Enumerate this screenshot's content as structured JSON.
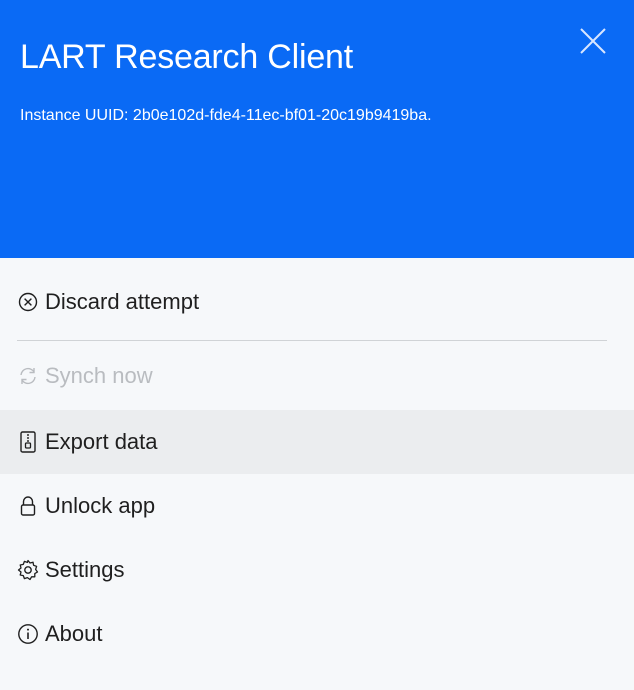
{
  "header": {
    "title": "LART Research Client",
    "uuid_text": "Instance UUID: 2b0e102d-fde4-11ec-bf01-20c19b9419ba.",
    "background": "#0a6af5"
  },
  "menu": {
    "items": [
      {
        "label": "Discard attempt",
        "icon": "circle-x-icon",
        "enabled": true
      },
      {
        "label": "Synch now",
        "icon": "sync-icon",
        "enabled": false
      },
      {
        "label": "Export data",
        "icon": "zip-file-icon",
        "enabled": true,
        "hovered": true
      },
      {
        "label": "Unlock app",
        "icon": "lock-icon",
        "enabled": true
      },
      {
        "label": "Settings",
        "icon": "gear-icon",
        "enabled": true
      },
      {
        "label": "About",
        "icon": "info-icon",
        "enabled": true
      }
    ]
  },
  "colors": {
    "menu_background": "#f6f8fa",
    "hover_background": "#ebedef",
    "disabled_text": "#b9bcc0",
    "text": "#1f1f1f"
  }
}
